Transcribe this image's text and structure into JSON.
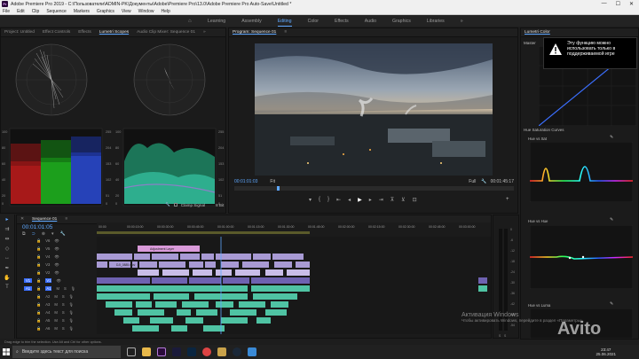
{
  "window": {
    "title": "Adobe Premiere Pro 2019 - C:\\Пользователи\\ADMIN-PK\\Документы\\Adobe\\Premiere Pro\\13.0\\Adobe Premiere Pro Auto-Save\\Untitled *",
    "logo": "Pr",
    "controls": [
      "—",
      "☐",
      "✕"
    ]
  },
  "menu": [
    "File",
    "Edit",
    "Clip",
    "Sequence",
    "Markers",
    "Graphics",
    "View",
    "Window",
    "Help"
  ],
  "workspaces": {
    "home_icon": "home-icon",
    "items": [
      "Learning",
      "Assembly",
      "Editing",
      "Color",
      "Effects",
      "Audio",
      "Graphics",
      "Libraries"
    ],
    "active": "Editing",
    "more": "»"
  },
  "scopes_panel": {
    "tabs": [
      "Project: Untitled",
      "Effect Controls",
      "Effects",
      "Lumetri Scopes",
      "Audio Clip Mixer: Sequence 01"
    ],
    "active_tab": "Lumetri Scopes",
    "more": "»",
    "left_scale": [
      "100",
      "90",
      "80",
      "70",
      "60",
      "50",
      "40",
      "30",
      "20",
      "10",
      "0"
    ],
    "mid_scale": [
      "255",
      "230",
      "204",
      "178",
      "153",
      "128",
      "102",
      "76",
      "51",
      "26",
      "0"
    ],
    "right_scale": [
      "100",
      "90",
      "80",
      "70",
      "60",
      "50",
      "40",
      "30",
      "20",
      "10",
      "0"
    ],
    "right_scale2": [
      "255",
      "230",
      "204",
      "178",
      "153",
      "128",
      "102",
      "76",
      "51",
      "26",
      "0"
    ],
    "clamp_signal": "Clamp Signal",
    "bit_depth": "8 Bit"
  },
  "program_monitor": {
    "tab": "Program: Sequence 01",
    "menu_icon": "≡",
    "timecode": "00:01:01:03",
    "fit": "Fit",
    "quality": "Full",
    "duration": "00:01:45:17"
  },
  "lumetri_panel": {
    "tab": "Lumetri Color",
    "master": "Master",
    "warning": "Эту функцию можно использовать только в поддерживаемой игре",
    "section": "Hue Saturation Curves",
    "curves": [
      "Hue vs Sat",
      "Hue vs Hue",
      "Hue vs Luma"
    ]
  },
  "timeline": {
    "tab": "Sequence 01",
    "menu_icon": "≡",
    "timecode": "00:01:01:05",
    "ruler": [
      "00:00",
      "00:00:15:00",
      "00:00:30:00",
      "00:00:45:00",
      "00:01:00:00",
      "00:01:15:00",
      "00:01:30:00",
      "00:01:45:00",
      "00:02:00:00",
      "00:02:15:00",
      "00:02:30:00",
      "00:02:45:00",
      "00:03:00:00"
    ],
    "tracks": [
      "V6",
      "V5",
      "V4",
      "V3",
      "V2",
      "V1",
      "A1",
      "A2",
      "A3",
      "A4",
      "A5",
      "A6"
    ],
    "clip_labels": [
      "Adjustment Layer",
      "DJI_0885.mov"
    ]
  },
  "meters": {
    "scale": [
      "0",
      "-6",
      "-12",
      "-18",
      "-24",
      "-30",
      "-36",
      "-42",
      "-48",
      "-54"
    ],
    "solo": [
      "S",
      "S"
    ]
  },
  "status": "Drag edge to trim the selection. Use Alt and Ctrl for other options.",
  "taskbar": {
    "search": "Введите здесь текст для поиска",
    "time": "23:47",
    "date": "25.06.2021"
  },
  "watermark": {
    "activation_title": "Активация Windows",
    "activation_sub": "Чтобы активировать Windows, перейдите в раздел «Параметры».",
    "brand": "Avito"
  },
  "colors": {
    "accent": "#5fa8ff",
    "clip_video": "#a89ad4",
    "clip_adjust": "#d99ad9",
    "clip_audio": "#4fc3a3"
  }
}
